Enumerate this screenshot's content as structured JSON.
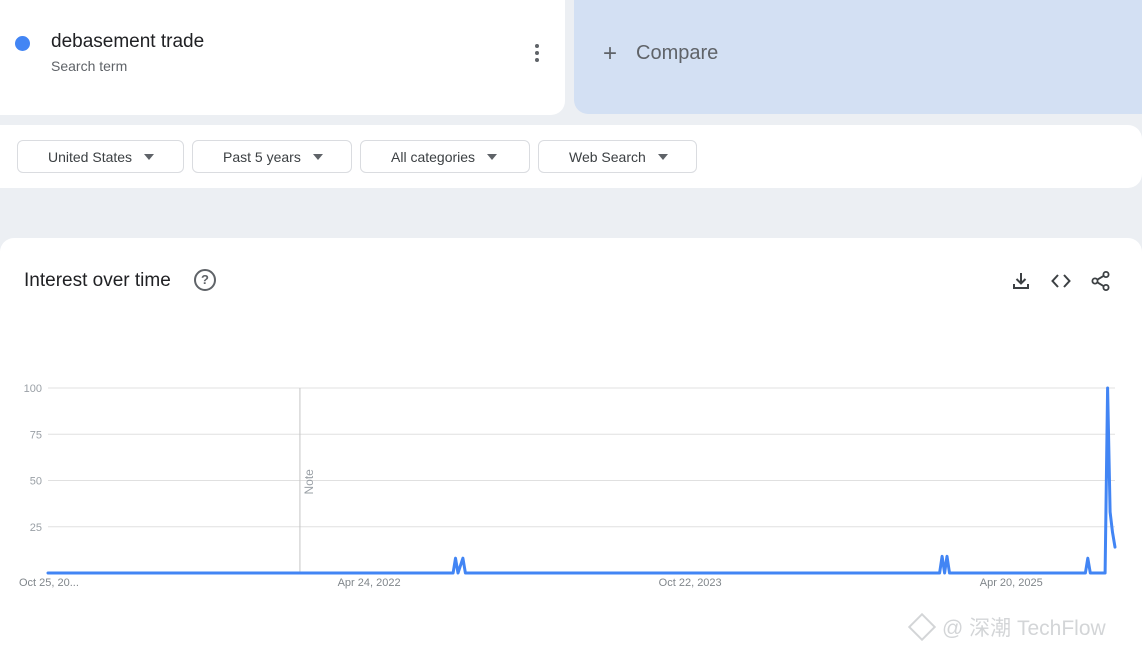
{
  "search_term": {
    "name": "debasement trade",
    "subtitle": "Search term",
    "dot_color": "#4285f4"
  },
  "compare": {
    "label": "Compare",
    "plus_icon": "plus-icon"
  },
  "filters": [
    {
      "label": "United States"
    },
    {
      "label": "Past 5 years"
    },
    {
      "label": "All categories"
    },
    {
      "label": "Web Search"
    }
  ],
  "card": {
    "title": "Interest over time",
    "help_icon": "help-circle-icon",
    "tools": [
      "download-icon",
      "embed-code-icon",
      "share-icon"
    ]
  },
  "watermark": "@ 深潮 TechFlow",
  "chart_data": {
    "type": "line",
    "title": "Interest over time",
    "xlabel": "",
    "ylabel": "",
    "ylim": [
      0,
      100
    ],
    "yticks": [
      100,
      75,
      50,
      25
    ],
    "xtick_labels": [
      "Oct 25, 20...",
      "Apr 24, 2022",
      "Oct 22, 2023",
      "Apr 20, 2025"
    ],
    "xtick_weeks": [
      0,
      130,
      260,
      390
    ],
    "note_week": 102,
    "note_label": "Note",
    "grid": true,
    "color": "#4285f4",
    "series": [
      {
        "x_weeks": [
          0,
          164,
          165,
          166,
          168,
          169,
          170,
          361,
          362,
          363,
          364,
          365,
          366,
          420,
          421,
          422,
          428,
          429,
          430,
          431,
          432
        ],
        "values": [
          0,
          0,
          8,
          0,
          8,
          0,
          0,
          0,
          9,
          0,
          9,
          0,
          0,
          0,
          8,
          0,
          0,
          100,
          33,
          22,
          14
        ]
      }
    ]
  }
}
